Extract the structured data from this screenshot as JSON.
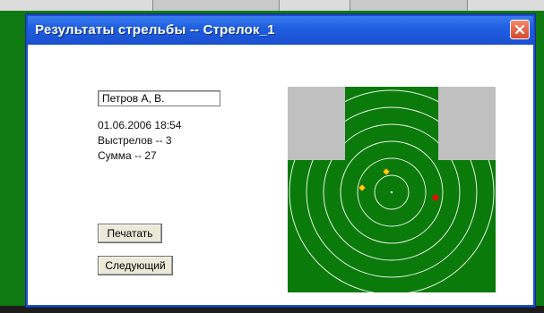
{
  "dialog": {
    "title": "Результаты стрельбы -- Стрелок_1"
  },
  "shooter": {
    "name": "Петров А, В.",
    "datetime": "01.06.2006 18:54",
    "shots": "Выстрелов -- 3",
    "total": "Сумма -- 27"
  },
  "buttons": {
    "print": "Печатать",
    "next": "Следующий"
  },
  "target": {
    "rings": 6,
    "shots": [
      {
        "color": "#ffd400"
      },
      {
        "color": "#ffd400"
      },
      {
        "color": "#e01010"
      }
    ]
  },
  "colors": {
    "titlebar": "#1f5fe0",
    "target_green": "#0a7a0a",
    "target_frame": "#c0c0c0",
    "close_button": "#d8472a"
  }
}
